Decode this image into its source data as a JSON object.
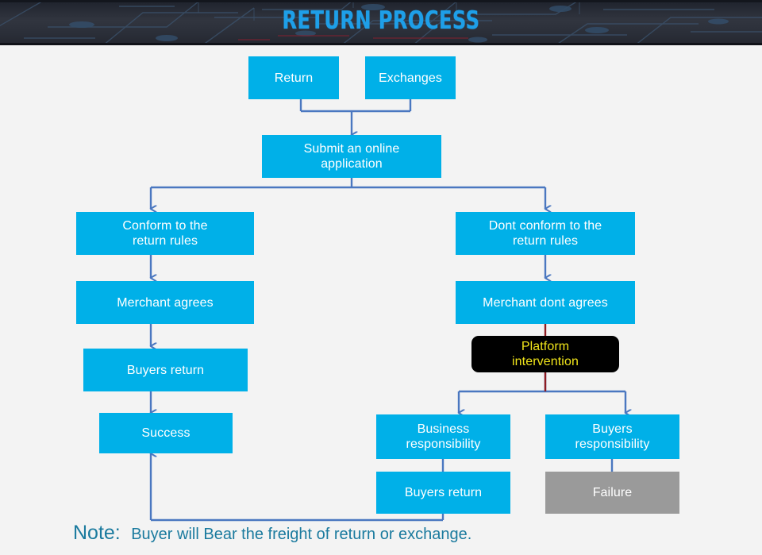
{
  "header": {
    "title": "RETURN PROCESS",
    "title_color": "#1e9fe8",
    "background_color": "#2b2f3a"
  },
  "theme": {
    "canvas_background": "#f3f3f3",
    "box_color": "#00b0e8",
    "box_text_color": "#ffffff",
    "connector_color": "#4a77c0",
    "highlight_box_color": "#000000",
    "highlight_text_color": "#f2e61a",
    "failure_box_color": "#9a9a9a",
    "red_line_color": "#8e1c22",
    "note_text_color": "#1a7a9e"
  },
  "nodes": {
    "return": {
      "label": "Return"
    },
    "exchanges": {
      "label": "Exchanges"
    },
    "submit": {
      "label": "Submit an online\napplication",
      "line1": "Submit an online",
      "line2": "application"
    },
    "conform": {
      "line1": "Conform to the",
      "line2": "return rules"
    },
    "dont_conform": {
      "line1": "Dont conform to the",
      "line2": "return rules"
    },
    "merchant_agrees": {
      "label": "Merchant agrees"
    },
    "merchant_dont_agrees": {
      "label": "Merchant dont agrees"
    },
    "buyers_return_left": {
      "label": "Buyers return"
    },
    "success": {
      "label": "Success"
    },
    "platform_intervention": {
      "line1": "Platform",
      "line2": "intervention"
    },
    "business_responsibility": {
      "line1": "Business",
      "line2": "responsibility"
    },
    "buyers_responsibility": {
      "line1": "Buyers",
      "line2": "responsibility"
    },
    "buyers_return_right": {
      "label": "Buyers return"
    },
    "failure": {
      "label": "Failure"
    }
  },
  "note": {
    "label": "Note:",
    "text": "Buyer will Bear the freight of return or exchange."
  }
}
